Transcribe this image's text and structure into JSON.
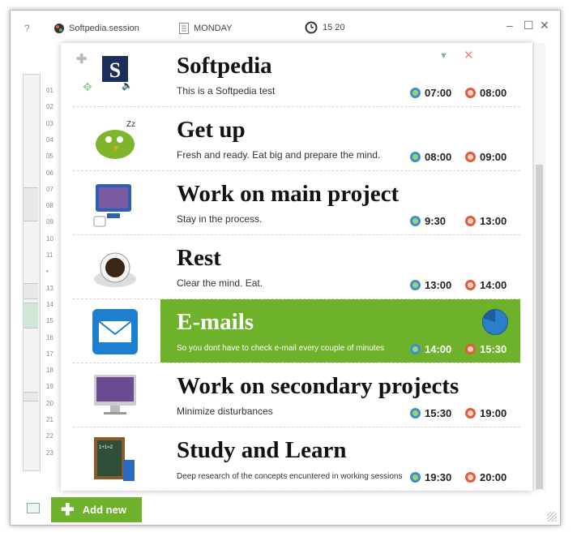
{
  "topbar": {
    "help": "?",
    "session": "Softpedia.session",
    "day": "MONDAY",
    "time": "15 20"
  },
  "timeline": {
    "ticks": [
      "01",
      "02",
      "03",
      "04",
      "05",
      "06",
      "07",
      "08",
      "09",
      "10",
      "11",
      "•",
      "13",
      "14",
      "15",
      "16",
      "17",
      "18",
      "19",
      "20",
      "21",
      "22",
      "23"
    ]
  },
  "tasks": [
    {
      "title": "Softpedia",
      "desc": "This is a Softpedia test",
      "start": "07:00",
      "end": "08:00",
      "icon": "softpedia-s-icon"
    },
    {
      "title": "Get up",
      "desc": "Fresh and ready. Eat big and prepare the mind.",
      "start": "08:00",
      "end": "09:00",
      "icon": "sleeping-bird-icon"
    },
    {
      "title": "Work on main project",
      "desc": "Stay in the process.",
      "start": "9:30",
      "end": "13:00",
      "icon": "computer-monitor-icon"
    },
    {
      "title": "Rest",
      "desc": "Clear the mind. Eat.",
      "start": "13:00",
      "end": "14:00",
      "icon": "coffee-cup-icon"
    },
    {
      "title": "E-mails",
      "desc": "So you dont have to check e-mail every couple of minutes",
      "start": "14:00",
      "end": "15:30",
      "icon": "email-envelope-icon"
    },
    {
      "title": "Work on secondary projects",
      "desc": "Minimize disturbances",
      "start": "15:30",
      "end": "19:00",
      "icon": "imac-icon"
    },
    {
      "title": "Study and Learn",
      "desc": "Deep research of the concepts encuntered in working sessions",
      "start": "19:30",
      "end": "20:00",
      "icon": "blackboard-books-icon"
    }
  ],
  "bottom": {
    "add_label": "Add new"
  },
  "colors": {
    "accent_green": "#6db22a",
    "active_row": "#6db22a"
  }
}
